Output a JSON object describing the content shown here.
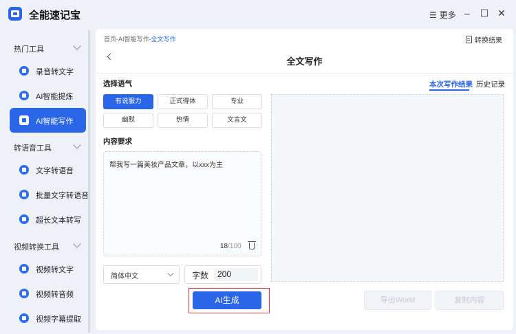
{
  "app": {
    "title": "全能速记宝",
    "more_label": "更多"
  },
  "window": {
    "more_icon": "menu-icon",
    "minimize_icon": "minimize-icon",
    "maximize_icon": "maximize-icon",
    "close_icon": "close-icon"
  },
  "sidebar": {
    "sections": [
      {
        "label": "热门工具",
        "items": [
          {
            "label": "录音转文字",
            "icon": "record-icon"
          },
          {
            "label": "AI智能提炼",
            "icon": "ai-extract-icon"
          },
          {
            "label": "AI智能写作",
            "icon": "ai-write-icon",
            "active": true
          }
        ]
      },
      {
        "label": "转语音工具",
        "items": [
          {
            "label": "文字转语音",
            "icon": "text-to-speech-icon"
          },
          {
            "label": "批量文字转语音",
            "icon": "batch-tts-icon"
          },
          {
            "label": "超长文本转写",
            "icon": "long-text-icon"
          }
        ]
      },
      {
        "label": "视频转换工具",
        "items": [
          {
            "label": "视频转文字",
            "icon": "video-to-text-icon"
          },
          {
            "label": "视频转音频",
            "icon": "video-to-audio-icon"
          },
          {
            "label": "视频字幕提取",
            "icon": "subtitle-extract-icon"
          }
        ]
      }
    ]
  },
  "main": {
    "breadcrumb": {
      "home": "首页",
      "sep": "-",
      "parent": "AI智能写作",
      "current": "全文写作"
    },
    "convert_label": "转换结果",
    "title": "全文写作",
    "tone_title": "选择语气",
    "tones": [
      "有说服力",
      "正式得体",
      "专业",
      "幽默",
      "热情",
      "文言文"
    ],
    "active_tone": "有说服力",
    "content_title": "内容要求",
    "content_text": "帮我写一篇美妆产品文章，以xxx为主",
    "char_count": "18",
    "char_max": "/100",
    "language": "简体中文",
    "word_count_label": "字数",
    "word_count": "200",
    "generate_label": "AI生成",
    "tab_current": "本次写作结果",
    "tab_history": "历史记录",
    "export_label": "导出World",
    "copy_label": "复制内容"
  },
  "colors": {
    "accent": "#2a66e8",
    "highlight": "#d93a3a"
  }
}
